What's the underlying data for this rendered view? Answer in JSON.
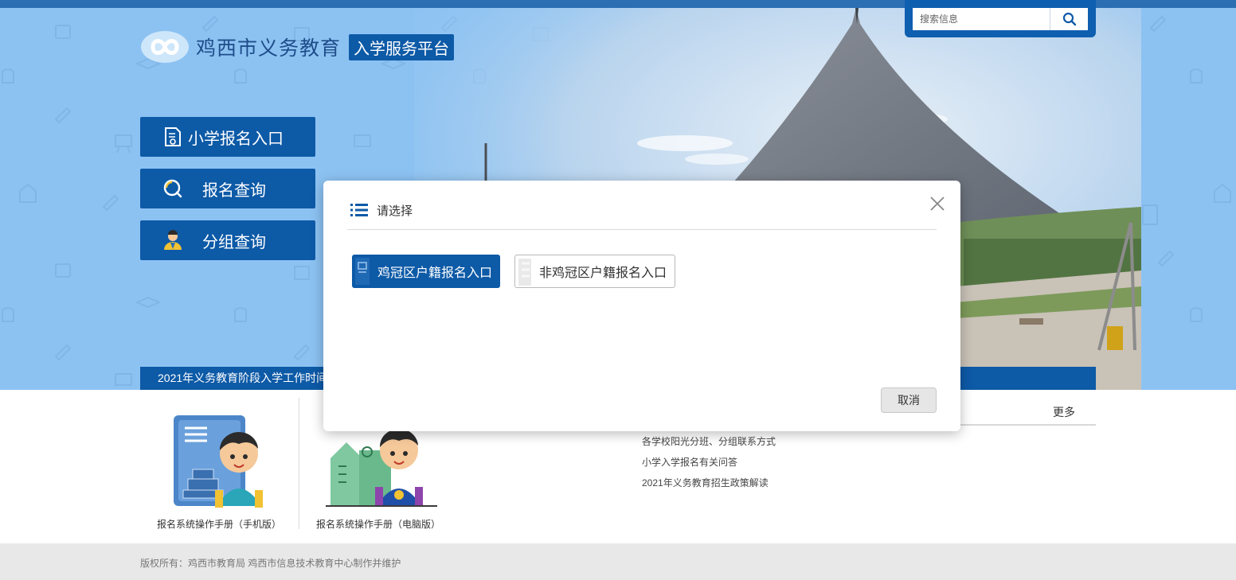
{
  "header": {
    "site_title": "鸡西市义务教育",
    "platform_badge": "入学服务平台"
  },
  "search": {
    "placeholder": "搜索信息",
    "icon": "search-icon"
  },
  "nav": {
    "items": [
      {
        "label": "小学报名入口",
        "icon": "document-icon"
      },
      {
        "label": "报名查询",
        "icon": "magnifier-icon"
      },
      {
        "label": "分组查询",
        "icon": "user-icon"
      }
    ]
  },
  "notice": {
    "text": "2021年义务教育阶段入学工作时间"
  },
  "guides": [
    {
      "label": "报名系统操作手册（手机版）"
    },
    {
      "label": "报名系统操作手册（电脑版）"
    }
  ],
  "news": {
    "more_label": "更多",
    "items": [
      "各学校阳光分班、分组联系方式",
      "小学入学报名有关问答",
      "2021年义务教育招生政策解读"
    ]
  },
  "footer": {
    "copyright": "版权所有：鸡西市教育局 鸡西市信息技术教育中心制作并维护"
  },
  "modal": {
    "title": "请选择",
    "options": [
      {
        "label": "鸡冠区户籍报名入口"
      },
      {
        "label": "非鸡冠区户籍报名入口"
      }
    ],
    "cancel_label": "取消"
  },
  "colors": {
    "primary": "#0d5aa7",
    "hero_bg": "#8cc2f2",
    "footer_bg": "#e8e8e8"
  }
}
